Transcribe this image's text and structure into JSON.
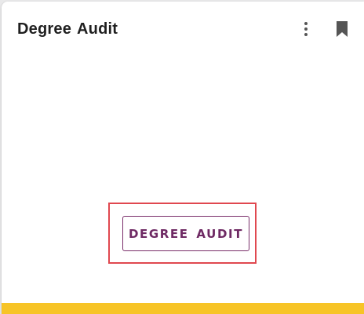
{
  "card": {
    "title": "Degree Audit",
    "menu_icon": "more-vertical-icon",
    "bookmark_icon": "bookmark-icon",
    "action_button_label": "DEGREE AUDIT",
    "accent_color": "#f7c427",
    "button_color": "#6e2963",
    "highlight_color": "#e0484f"
  }
}
